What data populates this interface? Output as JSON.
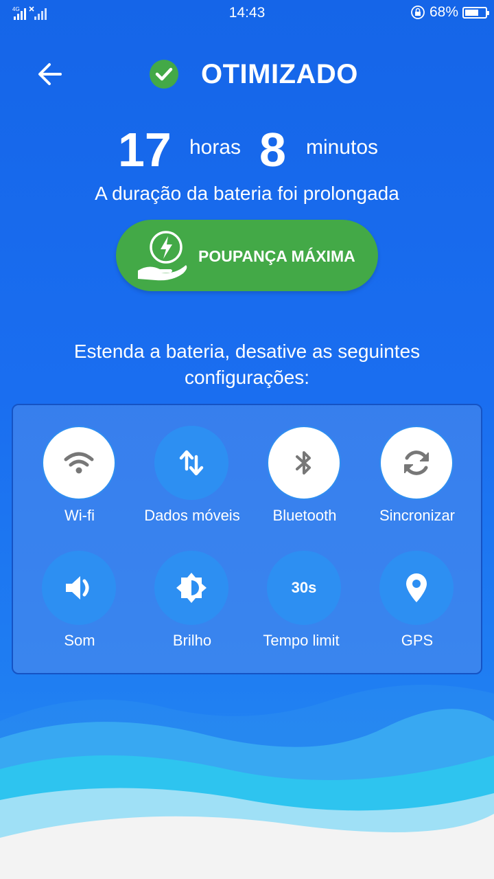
{
  "status_bar": {
    "network": "4G",
    "time": "14:43",
    "battery_percent": "68%",
    "battery_level": 0.68
  },
  "header": {
    "back_icon": "arrow-left-icon",
    "status_icon": "check-circle-icon",
    "title": "OTIMIZADO"
  },
  "duration": {
    "hours_value": "17",
    "hours_unit": "horas",
    "minutes_value": "8",
    "minutes_unit": "minutos",
    "subtitle": "A duração da bateria foi prolongada"
  },
  "max_saving_button": {
    "label": "POUPANÇA MÁXIMA",
    "icon": "hand-lightning-icon",
    "color": "#43a947"
  },
  "hint": {
    "line1": "Estenda a bateria, desative as seguintes",
    "line2": "configurações:"
  },
  "settings": [
    {
      "label": "Wi-fi",
      "icon": "wifi-icon",
      "active": true
    },
    {
      "label": "Dados móveis",
      "icon": "mobile-data-icon",
      "active": false
    },
    {
      "label": "Bluetooth",
      "icon": "bluetooth-icon",
      "active": true
    },
    {
      "label": "Sincronizar",
      "icon": "sync-icon",
      "active": true
    },
    {
      "label": "Som",
      "icon": "sound-icon",
      "active": false
    },
    {
      "label": "Brilho",
      "icon": "brightness-icon",
      "active": false
    },
    {
      "label": "Tempo limit",
      "icon": "timeout-icon",
      "icon_text": "30s",
      "active": false
    },
    {
      "label": "GPS",
      "icon": "gps-icon",
      "active": false
    }
  ],
  "colors": {
    "background": "#1a6ef0",
    "tile_active": "#ffffff",
    "tile_inactive": "#2d8ff2",
    "icon_active": "#777777"
  }
}
